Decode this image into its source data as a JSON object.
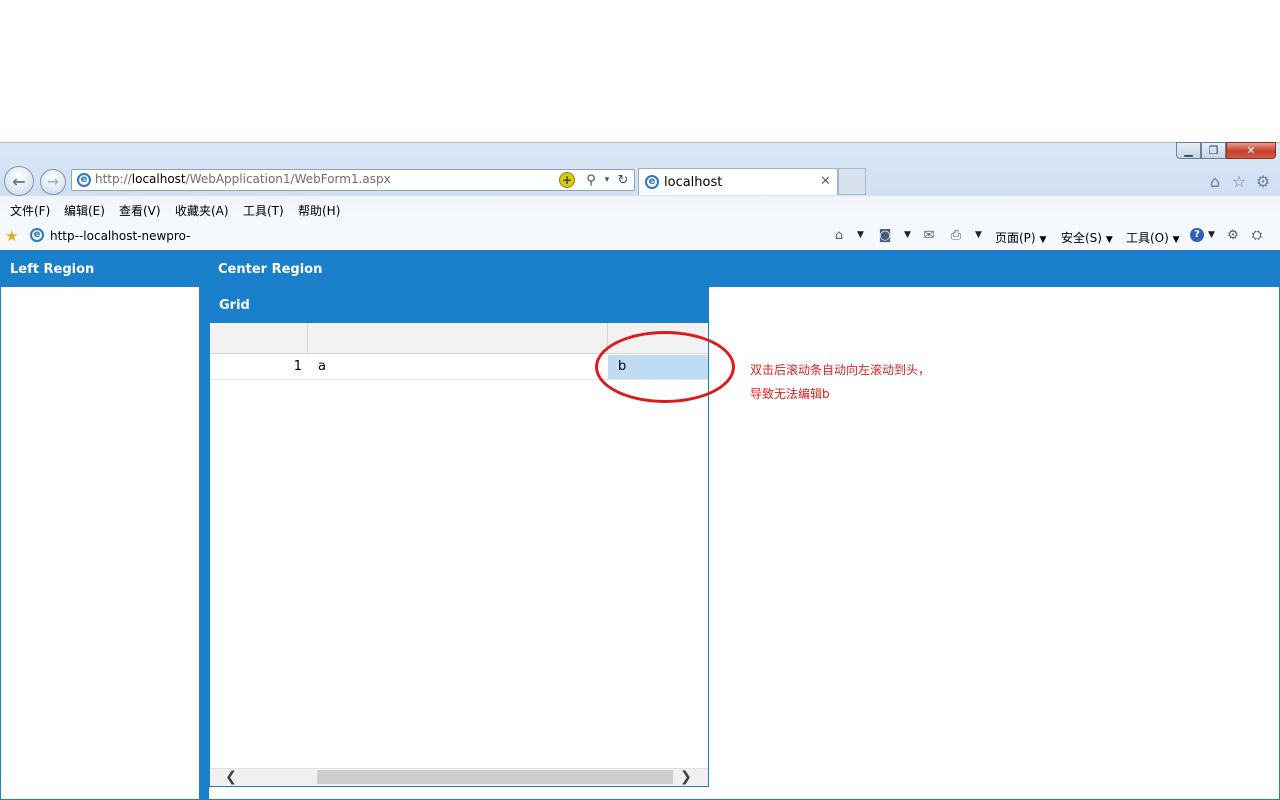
{
  "browser": {
    "address_prefix": "http://",
    "address_host": "localhost",
    "address_path": "/WebApplication1/WebForm1.aspx",
    "tab_title": "localhost",
    "menu": [
      "文件(F)",
      "编辑(E)",
      "查看(V)",
      "收藏夹(A)",
      "工具(T)",
      "帮助(H)"
    ],
    "favorite_label": "http--localhost-newpro-",
    "commands": {
      "page": "页面(P)",
      "safety": "安全(S)",
      "tools": "工具(O)"
    }
  },
  "page": {
    "left_region_title": "Left Region",
    "center_region_title": "Center Region",
    "grid": {
      "title": "Grid",
      "rows": [
        {
          "num": "1",
          "col1": "a",
          "col2": "b"
        }
      ]
    }
  },
  "annotation": {
    "line1": "双击后滚动条自动向左滚动到头，",
    "line2": "导致无法编辑b",
    "color": "#e21818"
  },
  "colors": {
    "region_header": "#1b80cc",
    "selected_cell": "#bfdcf3"
  },
  "icons": [
    "back-icon",
    "forward-icon",
    "ie-page-icon",
    "compat-view-icon",
    "search-icon",
    "refresh-icon",
    "home-icon",
    "favorites-star-icon",
    "settings-gear-icon",
    "rss-feed-icon",
    "read-mail-icon",
    "print-icon",
    "help-icon"
  ]
}
